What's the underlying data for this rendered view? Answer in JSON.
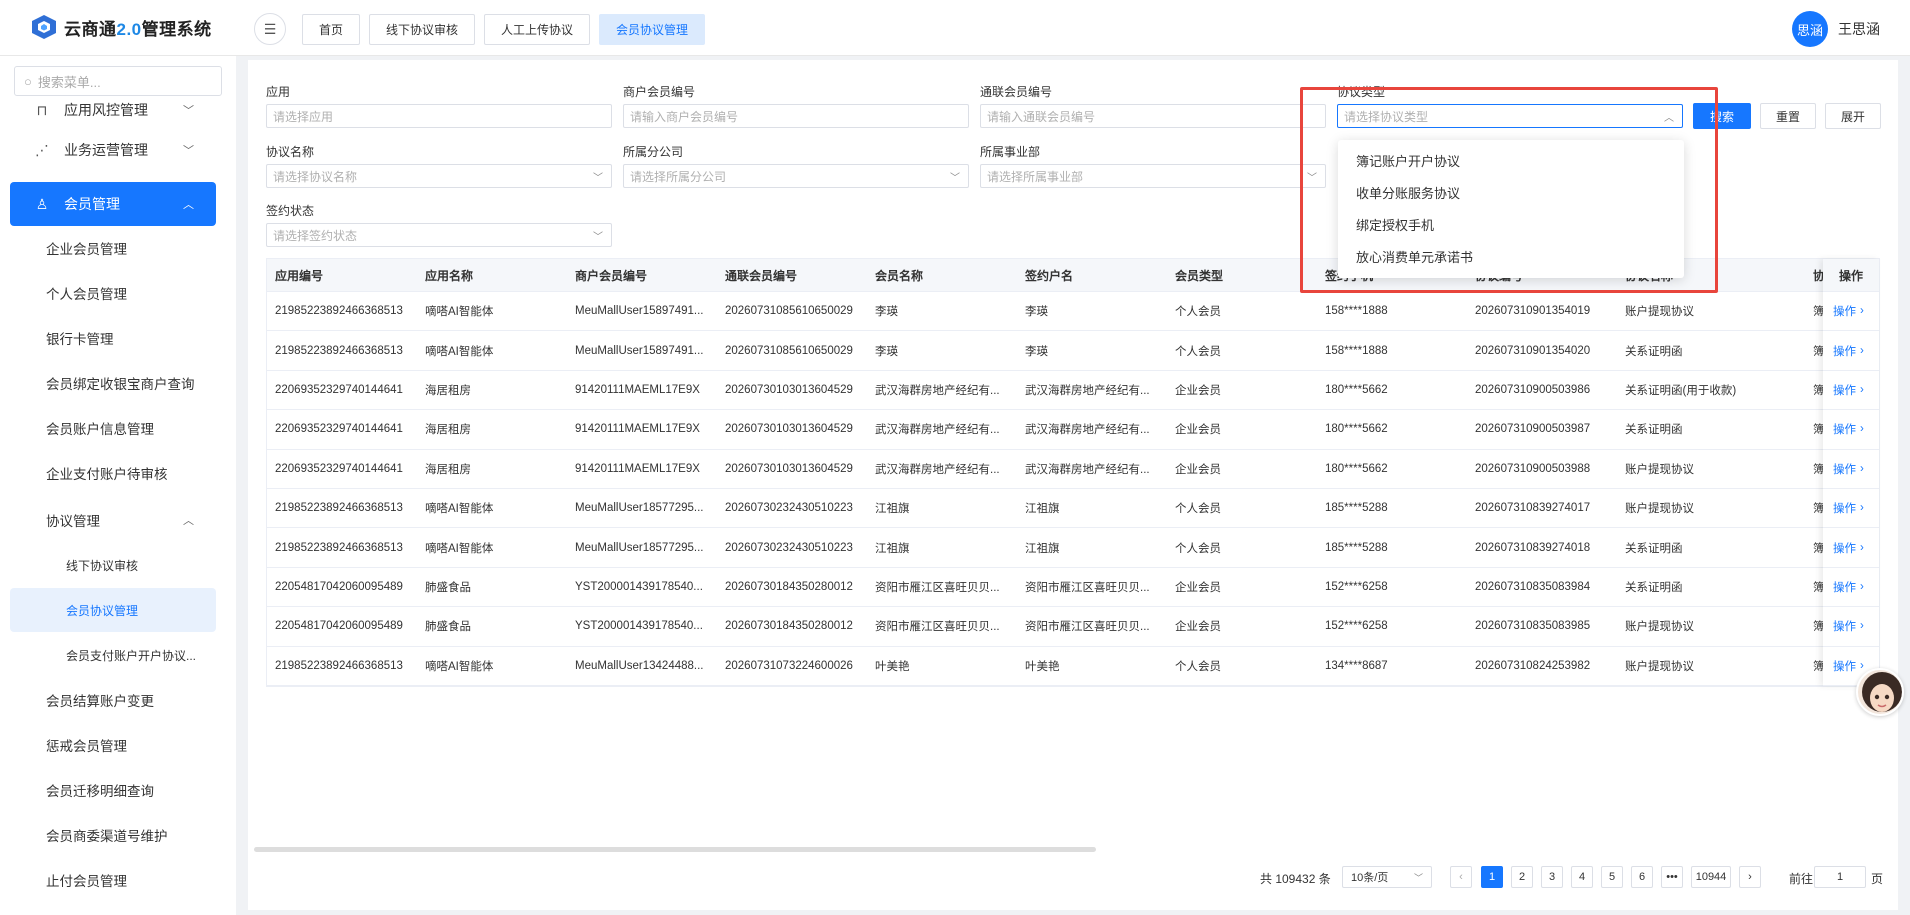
{
  "app": {
    "title_prefix": "云商通",
    "title_version": "2.0",
    "title_suffix": "管理系统"
  },
  "top_tabs": [
    {
      "label": "首页",
      "active": false
    },
    {
      "label": "线下协议审核",
      "active": false
    },
    {
      "label": "人工上传协议",
      "active": false
    },
    {
      "label": "会员协议管理",
      "active": true
    }
  ],
  "user": {
    "avatar_text": "思涵",
    "name": "王思涵"
  },
  "sidebar": {
    "search_placeholder": "搜索菜单...",
    "items": [
      {
        "label": "应用风控管理",
        "icon": "shield-icon"
      },
      {
        "label": "业务运营管理",
        "icon": "chart-icon"
      },
      {
        "label": "会员管理",
        "icon": "user-icon"
      }
    ],
    "subitems": [
      "企业会员管理",
      "个人会员管理",
      "银行卡管理",
      "会员绑定收银宝商户查询",
      "会员账户信息管理",
      "企业支付账户待审核",
      "协议管理"
    ],
    "sub3": [
      "线下协议审核",
      "会员协议管理",
      "会员支付账户开户协议..."
    ],
    "more": [
      "会员结算账户变更",
      "惩戒会员管理",
      "会员迁移明细查询",
      "会员商委渠道号维护",
      "止付会员管理"
    ]
  },
  "filters": {
    "app": {
      "label": "应用",
      "placeholder": "请选择应用"
    },
    "merchant_no": {
      "label": "商户会员编号",
      "placeholder": "请输入商户会员编号"
    },
    "tonglian_no": {
      "label": "通联会员编号",
      "placeholder": "请输入通联会员编号"
    },
    "agreement_type": {
      "label": "协议类型",
      "placeholder": "请选择协议类型"
    },
    "agreement_name": {
      "label": "协议名称",
      "placeholder": "请选择协议名称"
    },
    "branch": {
      "label": "所属分公司",
      "placeholder": "请选择所属分公司"
    },
    "division": {
      "label": "所属事业部",
      "placeholder": "请选择所属事业部"
    },
    "sign_status": {
      "label": "签约状态",
      "placeholder": "请选择签约状态"
    }
  },
  "buttons": {
    "search": "搜索",
    "reset": "重置",
    "expand": "展开"
  },
  "dropdown_options": [
    "簿记账户开户协议",
    "收单分账服务协议",
    "绑定授权手机",
    "放心消费单元承诺书"
  ],
  "table": {
    "headers": [
      "应用编号",
      "应用名称",
      "商户会员编号",
      "通联会员编号",
      "会员名称",
      "签约户名",
      "会员类型",
      "签约手机",
      "协议编号",
      "协议名称",
      "协"
    ],
    "op_header": "操作",
    "op_label": "操作",
    "rows": [
      [
        "2198522389246636851​3",
        "嘀嗒AI智能体",
        "MeuMallUser15897491...",
        "20260731085610650029",
        "李瑛",
        "李瑛",
        "个人会员",
        "158****1888",
        "202607310901354019",
        "账户提现协议",
        "簿"
      ],
      [
        "21985223892466368513",
        "嘀嗒AI智能体",
        "MeuMallUser15897491...",
        "20260731085610650029",
        "李瑛",
        "李瑛",
        "个人会员",
        "158****1888",
        "202607310901354020",
        "关系证明函",
        "簿"
      ],
      [
        "22069352329740144641",
        "海居租房",
        "91420111MAEML17E9X",
        "20260730103013604529",
        "武汉海群房地产经纪有...",
        "武汉海群房地产经纪有...",
        "企业会员",
        "180****5662",
        "202607310900503986",
        "关系证明函(用于收款)",
        "簿"
      ],
      [
        "22069352329740144641",
        "海居租房",
        "91420111MAEML17E9X",
        "20260730103013604529",
        "武汉海群房地产经纪有...",
        "武汉海群房地产经纪有...",
        "企业会员",
        "180****5662",
        "202607310900503987",
        "关系证明函",
        "簿"
      ],
      [
        "22069352329740144641",
        "海居租房",
        "91420111MAEML17E9X",
        "20260730103013604529",
        "武汉海群房地产经纪有...",
        "武汉海群房地产经纪有...",
        "企业会员",
        "180****5662",
        "202607310900503988",
        "账户提现协议",
        "簿"
      ],
      [
        "21985223892466368513",
        "嘀嗒AI智能体",
        "MeuMallUser18577295...",
        "20260730232430510223",
        "江祖旗",
        "江祖旗",
        "个人会员",
        "185****5288",
        "202607310839274017",
        "账户提现协议",
        "簿"
      ],
      [
        "21985223892466368513",
        "嘀嗒AI智能体",
        "MeuMallUser18577295...",
        "20260730232430510223",
        "江祖旗",
        "江祖旗",
        "个人会员",
        "185****5288",
        "202607310839274018",
        "关系证明函",
        "簿"
      ],
      [
        "22054817042060095489",
        "肺盛食品",
        "YST200001439178540...",
        "20260730184350280012",
        "资阳市雁江区喜旺贝贝...",
        "资阳市雁江区喜旺贝贝...",
        "企业会员",
        "152****6258",
        "202607310835083984",
        "关系证明函",
        "簿"
      ],
      [
        "22054817042060095489",
        "肺盛食品",
        "YST200001439178540...",
        "20260730184350280012",
        "资阳市雁江区喜旺贝贝...",
        "资阳市雁江区喜旺贝贝...",
        "企业会员",
        "152****6258",
        "202607310835083985",
        "账户提现协议",
        "簿"
      ],
      [
        "21985223892466368513",
        "嘀嗒AI智能体",
        "MeuMallUser13424488...",
        "20260731073224600026",
        "叶美艳",
        "叶美艳",
        "个人会员",
        "134****8687",
        "202607310824253982",
        "账户提现协议",
        "簿"
      ]
    ]
  },
  "pagination": {
    "total": "共 109432 条",
    "page_size": "10条/页",
    "pages": [
      "1",
      "2",
      "3",
      "4",
      "5",
      "6",
      "•••",
      "10944"
    ],
    "goto_label": "前往",
    "goto_value": "1",
    "page_unit": "页"
  },
  "colors": {
    "accent": "#1677ff",
    "highlight": "#e8453c"
  }
}
